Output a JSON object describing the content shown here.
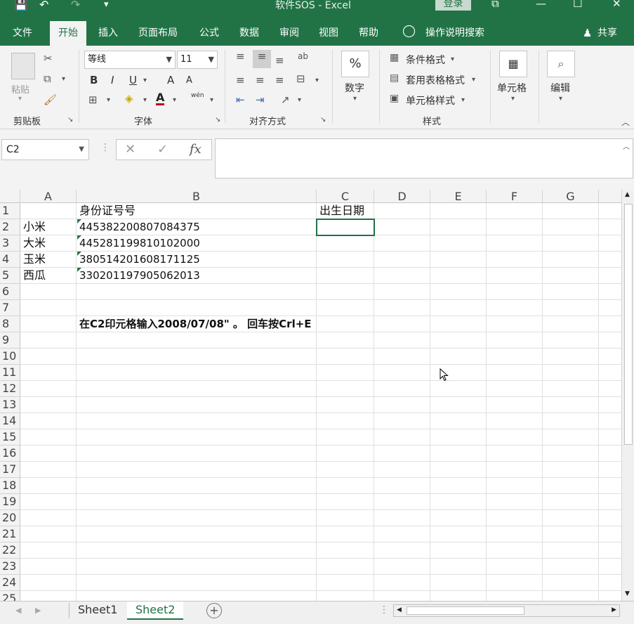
{
  "window": {
    "title": "软件SOS  -  Excel",
    "login_label": "登录"
  },
  "quick_access": {
    "save": "💾",
    "undo": "↶",
    "redo": "↷",
    "customize": "▾"
  },
  "window_controls": {
    "ribbon_opts": "⧉",
    "minimize": "—",
    "maximize": "☐",
    "close": "✕"
  },
  "tabs": [
    "文件",
    "开始",
    "插入",
    "页面布局",
    "公式",
    "数据",
    "审阅",
    "视图",
    "帮助"
  ],
  "active_tab": "开始",
  "tell_me": "操作说明搜索",
  "share": "共享",
  "ribbon": {
    "clipboard": {
      "label": "剪贴板",
      "paste": "粘贴"
    },
    "font": {
      "label": "字体",
      "name": "等线",
      "size": "11",
      "bold": "B",
      "italic": "I",
      "underline": "U",
      "grow": "A",
      "shrink": "A",
      "font_color": "A",
      "phonetic": "wén"
    },
    "alignment": {
      "label": "对齐方式"
    },
    "number": {
      "label": "数字",
      "percent": "%"
    },
    "styles": {
      "label": "样式",
      "conditional": "条件格式",
      "table": "套用表格格式",
      "cell_styles": "单元格样式"
    },
    "cells": {
      "label": "单元格"
    },
    "editing": {
      "label": "编辑"
    }
  },
  "formula_bar": {
    "name_box": "C2",
    "cancel": "✕",
    "enter": "✓",
    "fx": "fx",
    "value": ""
  },
  "columns": [
    "A",
    "B",
    "C",
    "D",
    "E",
    "F",
    "G"
  ],
  "rows": [
    "1",
    "2",
    "3",
    "4",
    "5",
    "6",
    "7",
    "8",
    "9",
    "10",
    "11",
    "12",
    "13",
    "14",
    "15",
    "16",
    "17",
    "18",
    "19",
    "20",
    "21",
    "22",
    "23",
    "24",
    "25"
  ],
  "cells": {
    "B1": "身份证号号",
    "C1": "出生日期",
    "A2": "小米",
    "B2": "445382200807084375",
    "A3": "大米",
    "B3": "445281199810102000",
    "A4": "玉米",
    "B4": "380514201608171125",
    "A5": "西瓜",
    "B5": "330201197905062013",
    "B8": "在C2印元格输入2008/07/08\" 。 回车按Crl+E"
  },
  "sheets": [
    "Sheet1",
    "Sheet2"
  ],
  "active_sheet": "Sheet2",
  "colors": {
    "accent": "#217346",
    "ribbon_bg": "#f3f3f3",
    "number_triangle": "#1e7b3a"
  }
}
